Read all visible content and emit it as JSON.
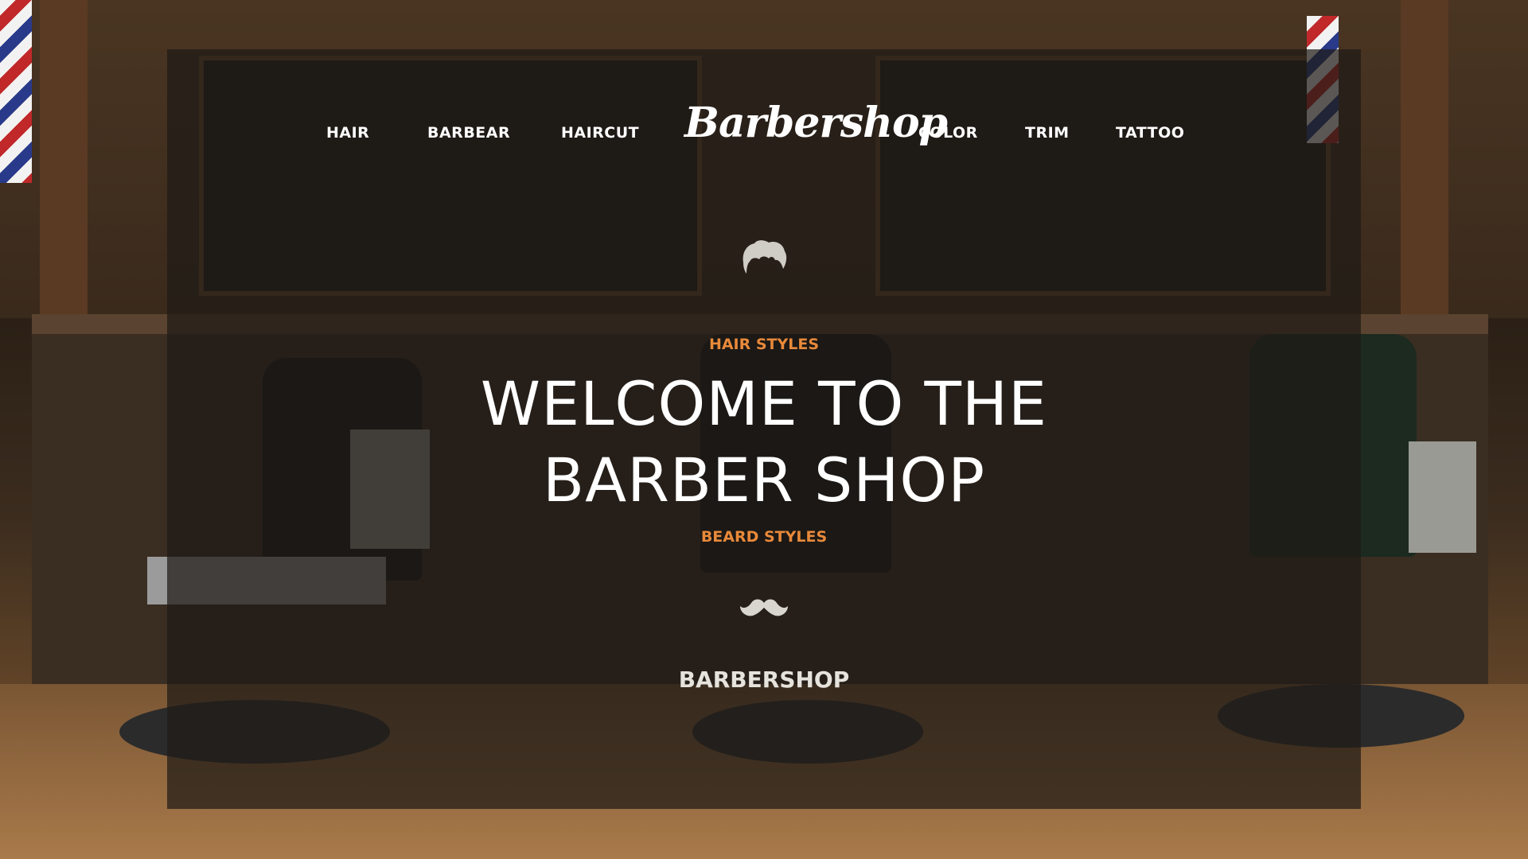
{
  "nav": {
    "left_links": [
      "HAIR",
      "BARBEAR",
      "HAIRCUT"
    ],
    "logo": "Barbershop",
    "right_links": [
      "COLOR",
      "TRIM",
      "TATTOO"
    ]
  },
  "hero": {
    "hair_icon": "hair-icon",
    "kicker_top": "HAIR STYLES",
    "headline_line1": "WELCOME TO THE",
    "headline_line2": "BARBER SHOP",
    "kicker_bottom": "BEARD STYLES",
    "mustache_icon": "mustache-icon",
    "brand": "BARBERSHOP"
  },
  "colors": {
    "accent": "#e8893a",
    "text": "#ffffff",
    "overlay": "rgba(30,26,22,0.72)"
  }
}
